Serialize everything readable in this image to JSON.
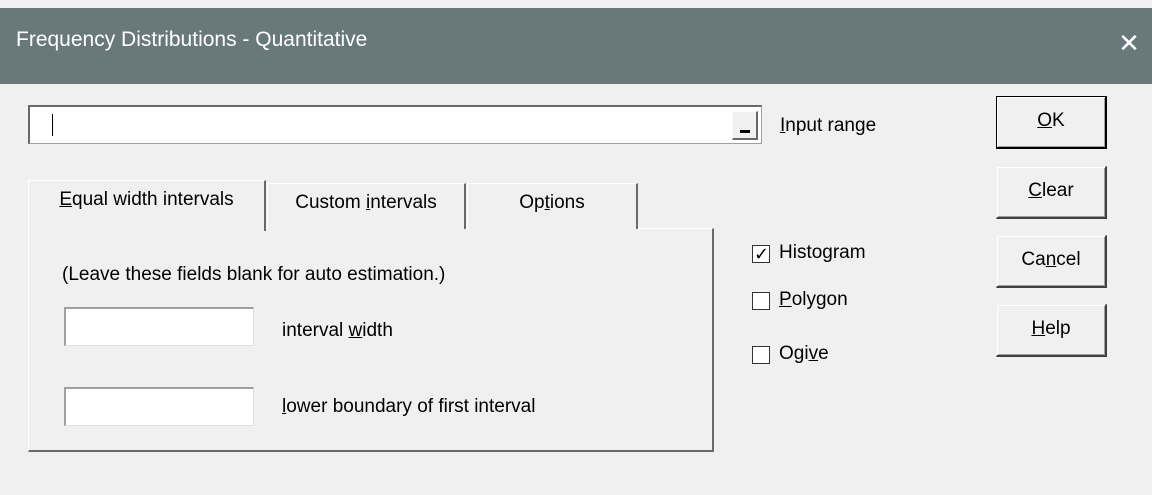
{
  "window": {
    "title": "Frequency Distributions - Quantitative",
    "close_glyph": "✕"
  },
  "input_range": {
    "value": "",
    "label_ul": "I",
    "label_rest": "nput range"
  },
  "tabs": [
    {
      "ul": "E",
      "rest": "qual width intervals",
      "pre": "",
      "active": true
    },
    {
      "pre": "Custom ",
      "ul": "i",
      "rest": "ntervals",
      "active": false
    },
    {
      "pre": "Op",
      "ul": "t",
      "rest": "ions",
      "active": false
    }
  ],
  "equal_width": {
    "hint": "(Leave these fields  blank for auto estimation.)",
    "interval_width": {
      "value": "",
      "label_pre": "interval ",
      "label_ul": "w",
      "label_rest": "idth"
    },
    "lower_boundary": {
      "value": "",
      "label_pre": "",
      "label_ul": "l",
      "label_rest": "ower boundary of first interval"
    }
  },
  "charts": {
    "histogram": {
      "pre": "",
      "ul": "",
      "rest": "Histogram",
      "checked": true,
      "check_glyph": "✓"
    },
    "polygon": {
      "pre": "",
      "ul": "P",
      "rest": "olygon",
      "checked": false
    },
    "ogive": {
      "pre": "Ogi",
      "ul": "v",
      "rest": "e",
      "checked": false
    }
  },
  "buttons": {
    "ok": {
      "pre": "",
      "ul": "O",
      "rest": "K"
    },
    "clear": {
      "pre": "",
      "ul": "C",
      "rest": "lear"
    },
    "cancel": {
      "pre": "Ca",
      "ul": "n",
      "rest": "cel"
    },
    "help": {
      "pre": "",
      "ul": "H",
      "rest": "elp"
    }
  }
}
